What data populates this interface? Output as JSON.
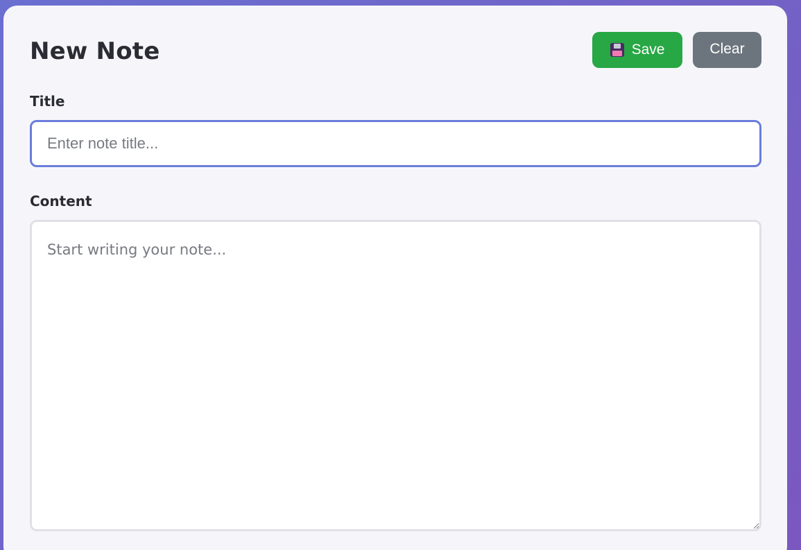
{
  "editor": {
    "heading": "New Note",
    "title_label": "Title",
    "title_placeholder": "Enter note title...",
    "title_value": "",
    "content_label": "Content",
    "content_placeholder": "Start writing your note...",
    "content_value": ""
  },
  "actions": {
    "save_label": "Save",
    "save_icon": "floppy-disk-icon",
    "clear_label": "Clear"
  },
  "colors": {
    "save": "#28a745",
    "clear": "#6c757d",
    "focus_border": "#6a7ddb",
    "background_gradient": [
      "#6a6fd0",
      "#7a58bf"
    ]
  }
}
